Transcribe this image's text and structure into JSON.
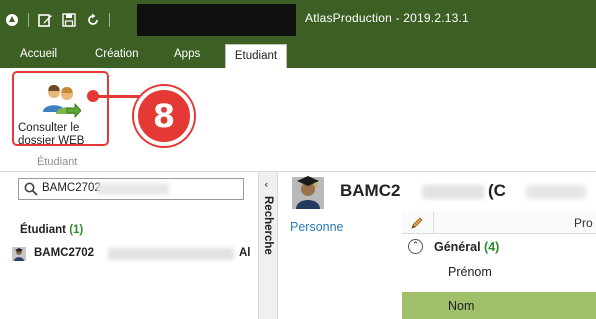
{
  "window": {
    "title": "AtlasProduction - 2019.2.13.1"
  },
  "quick_access": {
    "items": [
      "app-menu-icon",
      "edit-icon",
      "save-icon",
      "refresh-icon"
    ]
  },
  "ribbon": {
    "tabs": [
      {
        "label": "Accueil",
        "active": false
      },
      {
        "label": "Création",
        "active": false
      },
      {
        "label": "Apps",
        "active": false
      },
      {
        "label": "Etudiant",
        "active": true
      }
    ],
    "consult_button_label": "Consulter le\ndossier WEB",
    "group_label": "Étudiant"
  },
  "callout": {
    "step": "8",
    "color": "#e53935"
  },
  "search": {
    "value": "BAMC2702"
  },
  "student_list": {
    "header": "Étudiant",
    "count": "(1)",
    "items": [
      {
        "id": "BAMC2702",
        "tail": "Al"
      }
    ]
  },
  "collapse_panel": {
    "chevron": "‹",
    "label": "Recherche"
  },
  "record": {
    "title": "BAMC2",
    "title_tail": "(C"
  },
  "nav": {
    "personne": "Personne"
  },
  "grid": {
    "column_header": "Pro",
    "group": {
      "title": "Général",
      "count": "(4)",
      "toggle": "⌃"
    },
    "rows": [
      {
        "label": "Prénom",
        "selected": false
      },
      {
        "label": "Nom",
        "selected": true
      }
    ]
  },
  "colors": {
    "titlebar": "#3c5f23",
    "selected_row": "#9fbf6a",
    "accent_count": "#2e8b2e",
    "link": "#2a7ab8"
  }
}
